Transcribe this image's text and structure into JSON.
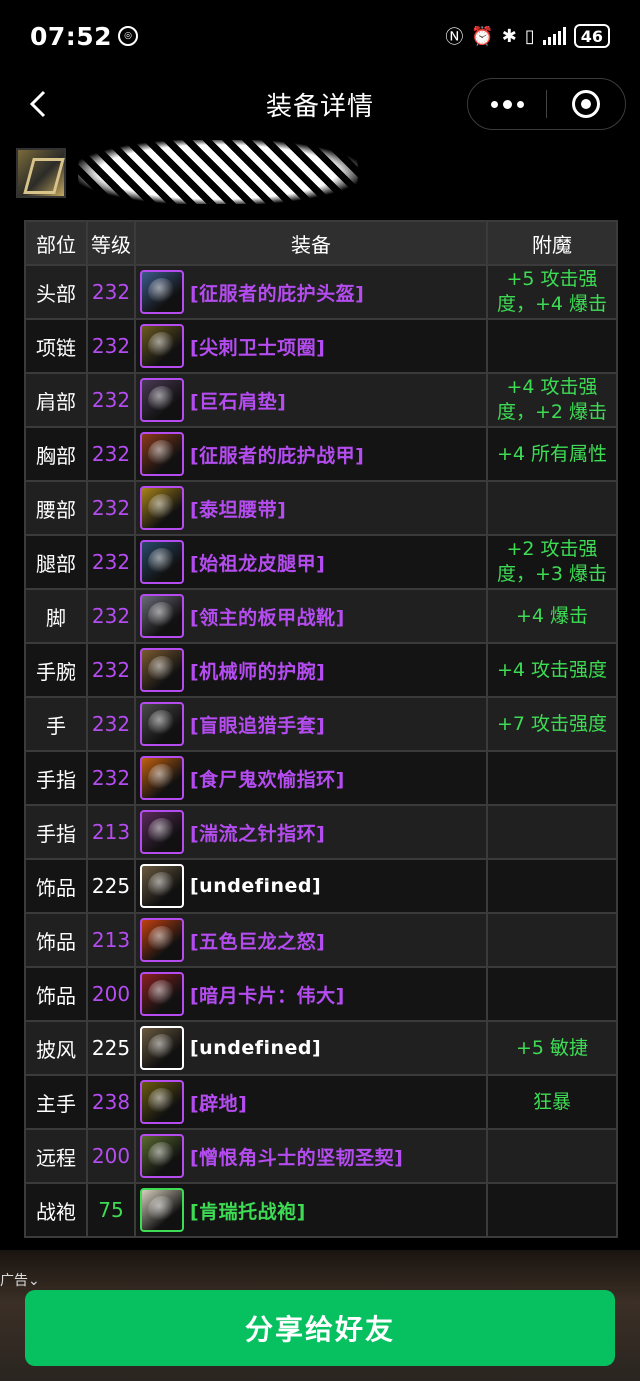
{
  "status_bar": {
    "time": "07:52",
    "battery": "46"
  },
  "nav": {
    "title": "装备详情"
  },
  "table": {
    "headers": [
      "部位",
      "等级",
      "装备",
      "附魔"
    ],
    "rows": [
      {
        "slot": "头部",
        "level": "232",
        "name": "[征服者的庇护头盔]",
        "enchant": "+5 攻击强度，+4 爆击",
        "quality_color": "#b44cf0",
        "icon_color": "#3c5a8a"
      },
      {
        "slot": "项链",
        "level": "232",
        "name": "[尖刺卫士项圈]",
        "enchant": "",
        "quality_color": "#b44cf0",
        "icon_color": "#6b5a20"
      },
      {
        "slot": "肩部",
        "level": "232",
        "name": "[巨石肩垫]",
        "enchant": "+4 攻击强度，+2 爆击",
        "quality_color": "#b44cf0",
        "icon_color": "#4a3a55"
      },
      {
        "slot": "胸部",
        "level": "232",
        "name": "[征服者的庇护战甲]",
        "enchant": "+4 所有属性",
        "quality_color": "#b44cf0",
        "icon_color": "#8a3a1a"
      },
      {
        "slot": "腰部",
        "level": "232",
        "name": "[泰坦腰带]",
        "enchant": "",
        "quality_color": "#b44cf0",
        "icon_color": "#a8841a"
      },
      {
        "slot": "腿部",
        "level": "232",
        "name": "[始祖龙皮腿甲]",
        "enchant": "+2 攻击强度，+3 爆击",
        "quality_color": "#b44cf0",
        "icon_color": "#2a4a6a"
      },
      {
        "slot": "脚",
        "level": "232",
        "name": "[领主的板甲战靴]",
        "enchant": "+4 爆击",
        "quality_color": "#b44cf0",
        "icon_color": "#6a6a78"
      },
      {
        "slot": "手腕",
        "level": "232",
        "name": "[机械师的护腕]",
        "enchant": "+4 攻击强度",
        "quality_color": "#b44cf0",
        "icon_color": "#7a5a30"
      },
      {
        "slot": "手",
        "level": "232",
        "name": "[盲眼追猎手套]",
        "enchant": "+7 攻击强度",
        "quality_color": "#b44cf0",
        "icon_color": "#4a4a4a"
      },
      {
        "slot": "手指",
        "level": "232",
        "name": "[食尸鬼欢愉指环]",
        "enchant": "",
        "quality_color": "#b44cf0",
        "icon_color": "#c06010"
      },
      {
        "slot": "手指",
        "level": "213",
        "name": "[湍流之针指环]",
        "enchant": "",
        "quality_color": "#b44cf0",
        "icon_color": "#5a2a5a"
      },
      {
        "slot": "饰品",
        "level": "225",
        "name": "[undefined]",
        "enchant": "",
        "quality_color": "#ffffff",
        "icon_color": "#6a5a40"
      },
      {
        "slot": "饰品",
        "level": "213",
        "name": "[五色巨龙之怒]",
        "enchant": "",
        "quality_color": "#b44cf0",
        "icon_color": "#c04010"
      },
      {
        "slot": "饰品",
        "level": "200",
        "name": "[暗月卡片：伟大]",
        "enchant": "",
        "quality_color": "#b44cf0",
        "icon_color": "#8a2020"
      },
      {
        "slot": "披风",
        "level": "225",
        "name": "[undefined]",
        "enchant": "+5 敏捷",
        "quality_color": "#ffffff",
        "icon_color": "#6a5a40"
      },
      {
        "slot": "主手",
        "level": "238",
        "name": "[辟地]",
        "enchant": "狂暴",
        "quality_color": "#b44cf0",
        "icon_color": "#6a5a10"
      },
      {
        "slot": "远程",
        "level": "200",
        "name": "[憎恨角斗士的坚韧圣契]",
        "enchant": "",
        "quality_color": "#b44cf0",
        "icon_color": "#5a6a30"
      },
      {
        "slot": "战袍",
        "level": "75",
        "name": "[肯瑞托战袍]",
        "enchant": "",
        "quality_color": "#3ddc54",
        "icon_color": "#d8d0c0"
      }
    ]
  },
  "ad": {
    "label": "广告"
  },
  "share_button": "分享给好友"
}
